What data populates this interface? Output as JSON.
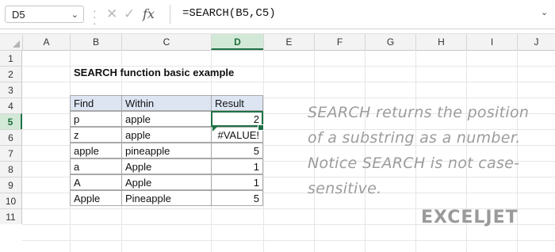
{
  "formula_bar": {
    "name_box": "D5",
    "name_box_arrow": "⌄",
    "cancel_icon": "✕",
    "enter_icon": "✓",
    "fx_label": "fx",
    "formula": "=SEARCH(B5,C5)",
    "expand_icon": "⌄"
  },
  "columns": [
    "A",
    "B",
    "C",
    "D",
    "E",
    "F",
    "G",
    "H",
    "I",
    "J"
  ],
  "selected_column": "D",
  "rows": [
    "1",
    "2",
    "3",
    "4",
    "5",
    "6",
    "7",
    "8",
    "9",
    "10",
    "11"
  ],
  "selected_row": "5",
  "title": "SEARCH function basic example",
  "table": {
    "headers": [
      "Find",
      "Within",
      "Result"
    ],
    "rows": [
      [
        "p",
        "apple",
        "2"
      ],
      [
        "z",
        "apple",
        "#VALUE!"
      ],
      [
        "apple",
        "pineapple",
        "5"
      ],
      [
        "a",
        "Apple",
        "1"
      ],
      [
        "A",
        "Apple",
        "1"
      ],
      [
        "Apple",
        "Pineapple",
        "5"
      ]
    ]
  },
  "note": "SEARCH returns the position of a substring as a number. Notice SEARCH is not case-sensitive.",
  "logo": "EXCELJET",
  "colors": {
    "selection_green": "#1e7145",
    "header_blue": "#dde5f3",
    "note_gray": "#9c9c9c"
  }
}
